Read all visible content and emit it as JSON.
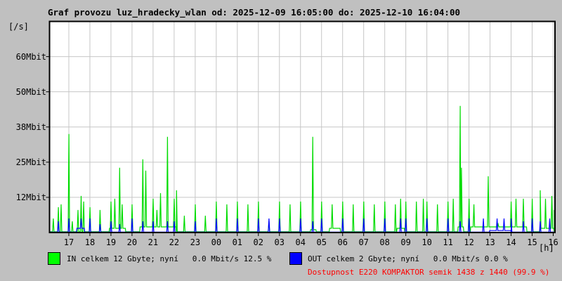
{
  "title": "Graf provozu luz_hradecky_wlan od: 2025-12-09 16:05:00 do: 2025-12-10 16:04:00",
  "y_unit_label": "[/s]",
  "x_unit_label": "[h]",
  "legend": {
    "in_label": "IN celkem 12 Gbyte; nyní   0.0 Mbit/s 12.5 %",
    "out_label": "OUT celkem 2 Gbyte; nyní   0.0 Mbit/s 0.0 %",
    "availability": "Dostupnost E220 KOMPAKTOR semik 1438 z 1440 (99.9 %)"
  },
  "colors": {
    "background": "#c0c0c0",
    "plot_background": "#ffffff",
    "grid": "#c6c6c6",
    "border": "#000000",
    "in_line": "#00dc00",
    "in_legend": "#00ff00",
    "out_line": "#0000ff",
    "out_legend": "#0000ff",
    "availability_text": "#ff0000"
  },
  "chart_data": {
    "type": "line",
    "title": "Graf provozu luz_hradecky_wlan",
    "time_from": "2025-12-09 16:05:00",
    "time_to": "2025-12-10 16:04:00",
    "x_span_hours": 24,
    "first_hour_tick_offset_hours": 0.9167,
    "x_tick_labels": [
      "17",
      "18",
      "19",
      "20",
      "21",
      "22",
      "23",
      "00",
      "01",
      "02",
      "03",
      "04",
      "05",
      "06",
      "07",
      "08",
      "09",
      "10",
      "11",
      "12",
      "13",
      "14",
      "15",
      "16"
    ],
    "y_ticks": [
      {
        "value": 12.5,
        "label": "12Mbit"
      },
      {
        "value": 25,
        "label": "25Mbit"
      },
      {
        "value": 37.5,
        "label": "38Mbit"
      },
      {
        "value": 50,
        "label": "50Mbit"
      },
      {
        "value": 62.5,
        "label": "60Mbit"
      }
    ],
    "ylim": [
      0,
      75
    ],
    "grid": true,
    "unit": "Mbit/s",
    "series": [
      {
        "name": "IN",
        "total": "12 Gbyte",
        "now_mbit": 0.0,
        "percent": 12.5,
        "baseline": 0.3,
        "baseline_segments": [
          [
            2.85,
            3.6,
            1.5
          ],
          [
            4.3,
            6.0,
            2
          ],
          [
            12.4,
            12.65,
            1
          ],
          [
            13.3,
            13.8,
            1.5
          ],
          [
            16.5,
            16.85,
            1.5
          ],
          [
            19.4,
            19.65,
            2
          ],
          [
            20.0,
            22.65,
            2
          ],
          [
            23.3,
            23.95,
            1.5
          ]
        ],
        "spikes_t_hours_value_mbit": [
          [
            0.18,
            5
          ],
          [
            0.42,
            9
          ],
          [
            0.55,
            10
          ],
          [
            0.92,
            35
          ],
          [
            1.08,
            4
          ],
          [
            1.35,
            8
          ],
          [
            1.5,
            13
          ],
          [
            1.62,
            11
          ],
          [
            1.92,
            9
          ],
          [
            2.4,
            8
          ],
          [
            2.92,
            11
          ],
          [
            3.1,
            12
          ],
          [
            3.33,
            23
          ],
          [
            3.45,
            10
          ],
          [
            3.92,
            10
          ],
          [
            4.43,
            26
          ],
          [
            4.57,
            22
          ],
          [
            4.92,
            12
          ],
          [
            5.1,
            8
          ],
          [
            5.27,
            14
          ],
          [
            5.6,
            34
          ],
          [
            5.92,
            12
          ],
          [
            6.03,
            15
          ],
          [
            6.4,
            6
          ],
          [
            6.92,
            10
          ],
          [
            7.4,
            6
          ],
          [
            7.92,
            11
          ],
          [
            8.42,
            10
          ],
          [
            8.92,
            11
          ],
          [
            9.42,
            10
          ],
          [
            9.92,
            11
          ],
          [
            10.42,
            4
          ],
          [
            10.92,
            11
          ],
          [
            11.42,
            10
          ],
          [
            11.92,
            11
          ],
          [
            12.5,
            34
          ],
          [
            12.92,
            11
          ],
          [
            13.42,
            10
          ],
          [
            13.92,
            11
          ],
          [
            14.42,
            10
          ],
          [
            14.92,
            11
          ],
          [
            15.42,
            10
          ],
          [
            15.92,
            11
          ],
          [
            16.42,
            10
          ],
          [
            16.67,
            12
          ],
          [
            16.92,
            11
          ],
          [
            17.42,
            11
          ],
          [
            17.75,
            12
          ],
          [
            17.92,
            11
          ],
          [
            18.42,
            10
          ],
          [
            18.92,
            11
          ],
          [
            19.17,
            12
          ],
          [
            19.5,
            45
          ],
          [
            19.56,
            23
          ],
          [
            19.92,
            12
          ],
          [
            20.15,
            10
          ],
          [
            20.83,
            20
          ],
          [
            21.3,
            3
          ],
          [
            21.92,
            11
          ],
          [
            22.15,
            12
          ],
          [
            22.5,
            12
          ],
          [
            22.92,
            12
          ],
          [
            23.3,
            15
          ],
          [
            23.55,
            12
          ],
          [
            23.85,
            13
          ],
          [
            23.97,
            8
          ]
        ]
      },
      {
        "name": "OUT",
        "total": "2 Gbyte",
        "now_mbit": 0.0,
        "percent": 0.0,
        "baseline": 0.15,
        "baseline_segments": [
          [
            1.3,
            1.65,
            1.5
          ],
          [
            20.9,
            21.9,
            0.7
          ]
        ],
        "spikes_t_hours_value_mbit": [
          [
            0.42,
            4
          ],
          [
            0.92,
            5
          ],
          [
            1.5,
            5
          ],
          [
            1.92,
            5
          ],
          [
            2.4,
            3
          ],
          [
            2.92,
            4
          ],
          [
            3.33,
            3
          ],
          [
            3.92,
            5
          ],
          [
            4.43,
            4
          ],
          [
            4.92,
            4
          ],
          [
            5.6,
            4
          ],
          [
            5.92,
            4
          ],
          [
            6.92,
            4
          ],
          [
            7.92,
            5
          ],
          [
            8.92,
            5
          ],
          [
            9.92,
            5
          ],
          [
            10.42,
            5
          ],
          [
            10.92,
            5
          ],
          [
            11.92,
            5
          ],
          [
            12.5,
            4
          ],
          [
            12.92,
            5
          ],
          [
            13.92,
            5
          ],
          [
            14.92,
            5
          ],
          [
            15.92,
            5
          ],
          [
            16.67,
            5
          ],
          [
            16.92,
            5
          ],
          [
            17.92,
            5
          ],
          [
            18.92,
            5
          ],
          [
            19.5,
            4
          ],
          [
            19.92,
            5
          ],
          [
            20.6,
            5
          ],
          [
            21.25,
            5
          ],
          [
            21.58,
            5
          ],
          [
            21.92,
            5
          ],
          [
            22.5,
            4
          ],
          [
            22.92,
            5
          ],
          [
            23.3,
            4
          ],
          [
            23.75,
            5
          ]
        ]
      }
    ]
  }
}
